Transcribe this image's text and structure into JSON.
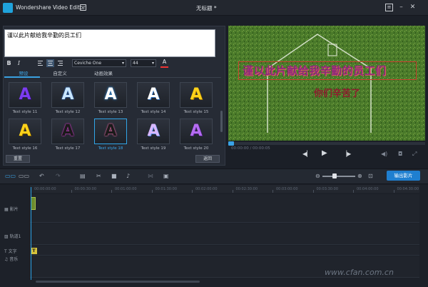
{
  "window": {
    "app_title": "Wondershare Video Editor",
    "doc_title": "无标题 *"
  },
  "editor": {
    "text_value": "谨以此片献给我辛勤的员工们",
    "bold_label": "B",
    "italic_label": "I",
    "font_value": "Ceviche One",
    "size_value": "44",
    "color_label": "A",
    "tabs": [
      {
        "label": "预设"
      },
      {
        "label": "自定义"
      },
      {
        "label": "动画效果"
      }
    ],
    "styles": [
      {
        "label": "Text style 11"
      },
      {
        "label": "Text style 12"
      },
      {
        "label": "Text style 13"
      },
      {
        "label": "Text style 14"
      },
      {
        "label": "Text style 15"
      },
      {
        "label": "Text style 16"
      },
      {
        "label": "Text style 17"
      },
      {
        "label": "Text style 18"
      },
      {
        "label": "Text style 19"
      },
      {
        "label": "Text style 20"
      }
    ],
    "style_glyph": "A",
    "reset_label": "重置",
    "back_label": "返回"
  },
  "preview": {
    "title_text": "谨以此片献给我辛勤的员工们",
    "subtitle_text": "你们辛苦了",
    "timecode": "00:00:00 / 00:00:05"
  },
  "toolbar": {
    "export_label": "输出影片"
  },
  "timeline": {
    "ruler": [
      "00:00:00:00",
      "00:00:30:00",
      "00:01:00:00",
      "00:01:30:00",
      "00:02:00:00",
      "00:02:30:00",
      "00:03:00:00",
      "00:03:30:00",
      "00:04:00:00",
      "00:04:30:00"
    ],
    "tracks": {
      "video": "影片",
      "overlay": "轨道1",
      "text": "文字",
      "music": "音乐"
    },
    "text_clip": "T"
  },
  "watermark": "www.cfan.com.cn"
}
